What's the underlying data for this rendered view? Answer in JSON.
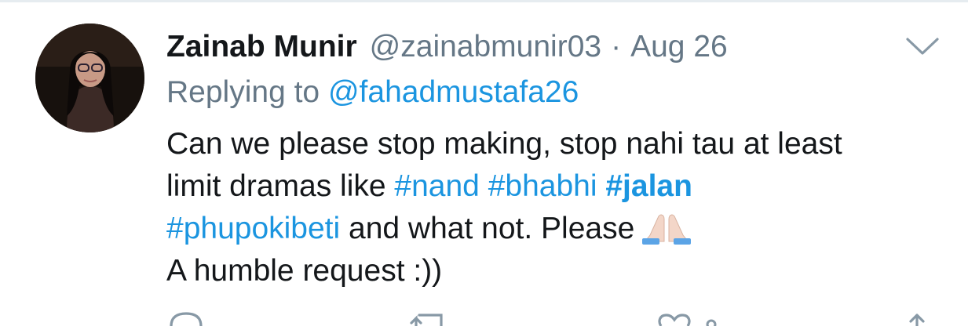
{
  "tweet": {
    "author_name": "Zainab Munir",
    "handle": "@zainabmunir03",
    "separator": "·",
    "date": "Aug 26",
    "replying_prefix": "Replying to",
    "replying_to": "@fahadmustafa26",
    "body": {
      "line1": "Can we please stop making, stop nahi tau at least",
      "line2_text": "limit dramas like",
      "tag_nand": "#nand",
      "tag_bhabhi": "#bhabhi",
      "tag_jalan": "#jalan",
      "tag_phupokibeti": "#phupokibeti",
      "line3_text": "and what not. Please",
      "line4": "A humble request :))"
    },
    "emoji_icon": "folded-hands-emoji",
    "menu_icon": "chevron-down-icon"
  },
  "actions": {
    "icons": [
      "reply-icon",
      "retweet-icon",
      "like-icon",
      "share-icon"
    ]
  },
  "colors": {
    "link": "#1b95e0",
    "secondary_text": "#657786",
    "primary_text": "#14171a",
    "icon": "#8899a6"
  }
}
